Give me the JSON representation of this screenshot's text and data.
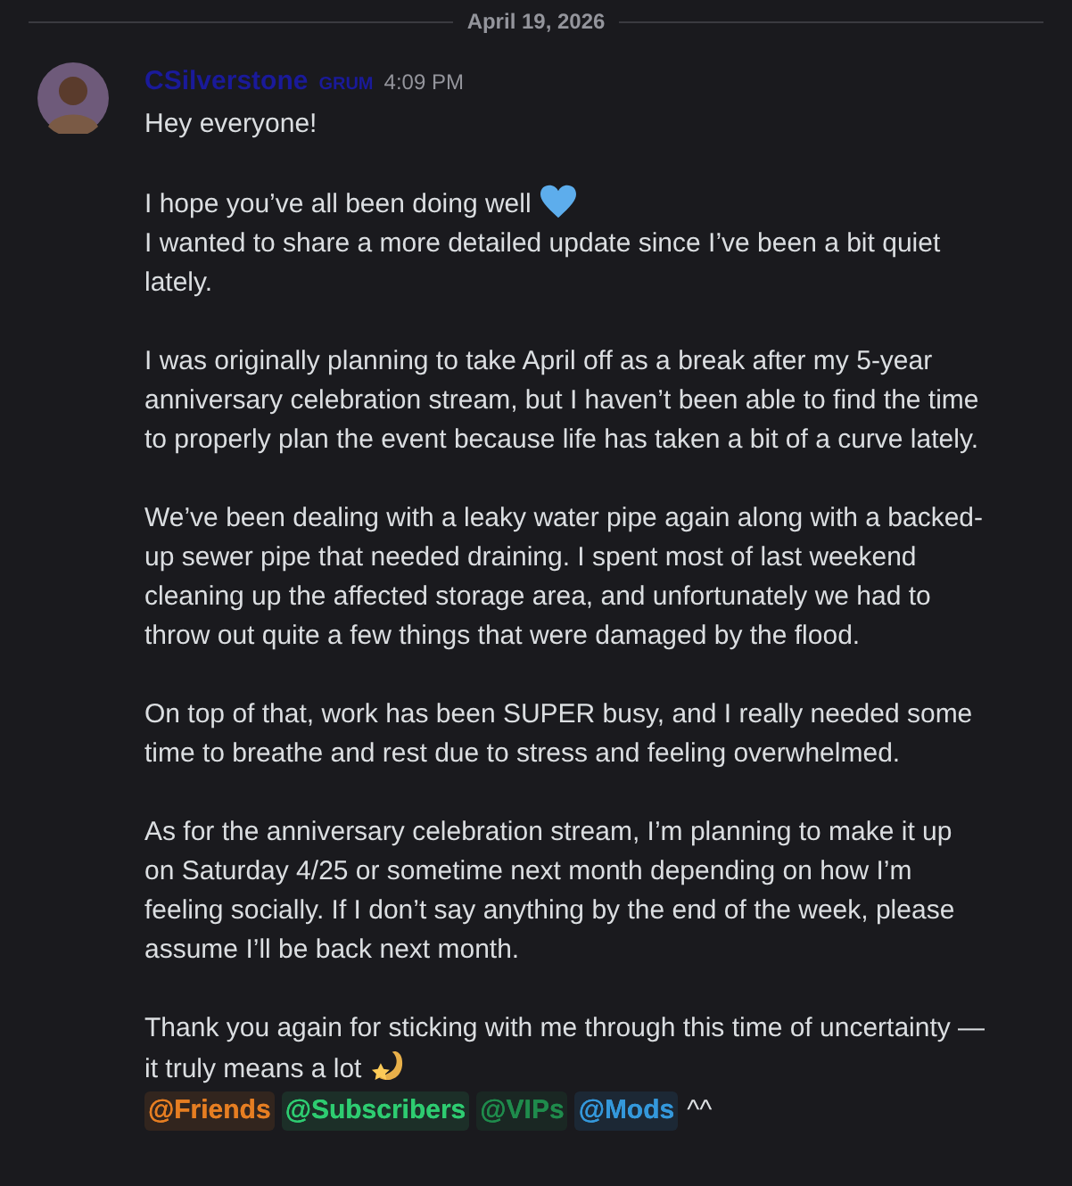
{
  "date_divider": "April 19, 2026",
  "message": {
    "author": "CSilverstone",
    "author_tag": "GRUM",
    "time": "4:09 PM",
    "paragraphs": [
      {
        "lines": [
          {
            "text": "Hey everyone!"
          }
        ]
      },
      {
        "lines": [
          {
            "text": "I hope you’ve all been doing well",
            "kind": "heart"
          },
          {
            "text": "I wanted to share a more detailed update since I’ve been a bit quiet lately."
          }
        ]
      },
      {
        "lines": [
          {
            "text": "I was originally planning to take April off as a break after my 5-year anniversary celebration stream, but I haven’t been able to find the time to properly plan the event because life has taken a bit of a curve lately."
          }
        ]
      },
      {
        "lines": [
          {
            "text": "We’ve been dealing with a leaky water pipe again along with a backed-up sewer pipe that needed draining. I spent most of last weekend cleaning up the affected storage area, and unfortunately we had to throw out quite a few things that were damaged by the flood."
          }
        ]
      },
      {
        "lines": [
          {
            "text": "On top of that, work has been SUPER busy, and I really needed some time to breathe and rest due to stress and feeling overwhelmed."
          }
        ]
      },
      {
        "lines": [
          {
            "text": "As for the anniversary celebration stream, I’m planning to make it up on Saturday 4/25 or sometime next month depending on how I’m feeling socially. If I don’t say anything by the end of the week, please assume I’ll be back next month."
          }
        ]
      },
      {
        "lines": [
          {
            "text": "Thank you again for sticking with me through this time of uncertainty —it truly means a lot",
            "kind": "shooting-star"
          }
        ]
      }
    ],
    "mentions": [
      {
        "text": "@Friends",
        "color": "#e67e22"
      },
      {
        "text": "@Subscribers",
        "color": "#2ecc71"
      },
      {
        "text": "@VIPs",
        "color": "#1f8b4c"
      },
      {
        "text": "@Mods",
        "color": "#3498db"
      }
    ],
    "trailing_text": "^^"
  }
}
